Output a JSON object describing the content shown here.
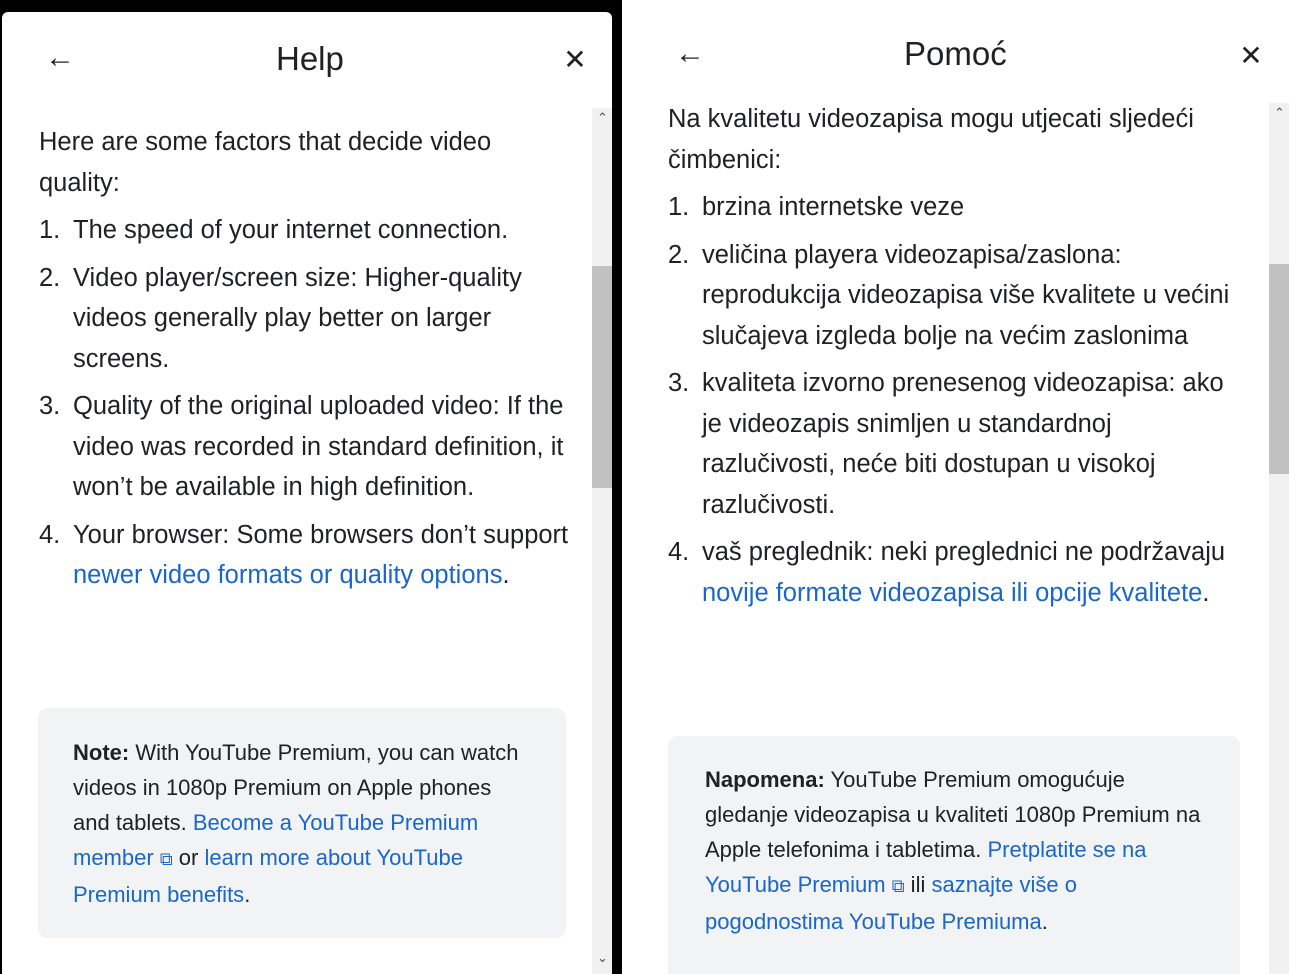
{
  "left": {
    "title": "Help",
    "intro": "Here are some factors that decide video quality:",
    "items": [
      {
        "num": "1.",
        "text": "The speed of your internet connection."
      },
      {
        "num": "2.",
        "text": "Video player/screen size: Higher-quality videos generally play better on larger screens."
      },
      {
        "num": "3.",
        "text": "Quality of the original uploaded video: If the video was recorded in standard definition, it won’t be available in high definition."
      },
      {
        "num": "4.",
        "text": "Your browser: Some browsers don’t support ",
        "link": "newer video formats or quality options",
        "after": "."
      }
    ],
    "note": {
      "label": "Note:",
      "text": " With YouTube Premium, you can watch videos in 1080p Premium on Apple phones and tablets. ",
      "link1": "Become a YouTube Premium member",
      "mid": " or ",
      "link2": "learn more about YouTube Premium benefits",
      "end": "."
    }
  },
  "right": {
    "title": "Pomoć",
    "intro": "Na kvalitetu videozapisa mogu utjecati sljedeći čimbenici:",
    "items": [
      {
        "num": "1.",
        "text": "brzina internetske veze"
      },
      {
        "num": "2.",
        "text": "veličina playera videozapisa/zaslona: reprodukcija videozapisa više kvalitete u većini slučajeva izgleda bolje na većim zaslonima"
      },
      {
        "num": "3.",
        "text": "kvaliteta izvorno prenesenog videozapisa: ako je videozapis snimljen u standardnoj razlučivosti, neće biti dostupan u visokoj razlučivosti."
      },
      {
        "num": "4.",
        "text": "vaš preglednik: neki preglednici ne podržavaju ",
        "link": "novije formate videozapisa ili opcije kvalitete",
        "after": "."
      }
    ],
    "note": {
      "label": "Napomena:",
      "text": " YouTube Premium omogućuje gledanje videozapisa u kvaliteti 1080p Premium na Apple telefonima i tabletima. ",
      "link1": "Pretplatite se na YouTube Premium",
      "mid": " ili ",
      "link2": "saznajte više o pogodnostima YouTube Premiuma",
      "end": "."
    }
  },
  "icons": {
    "back": "←",
    "close": "✕",
    "external": "⧉",
    "scroll_up": "⌃",
    "scroll_down": "⌄"
  },
  "colors": {
    "link": "#1a66c9",
    "note_bg": "#f1f3f4",
    "text": "#202124"
  }
}
